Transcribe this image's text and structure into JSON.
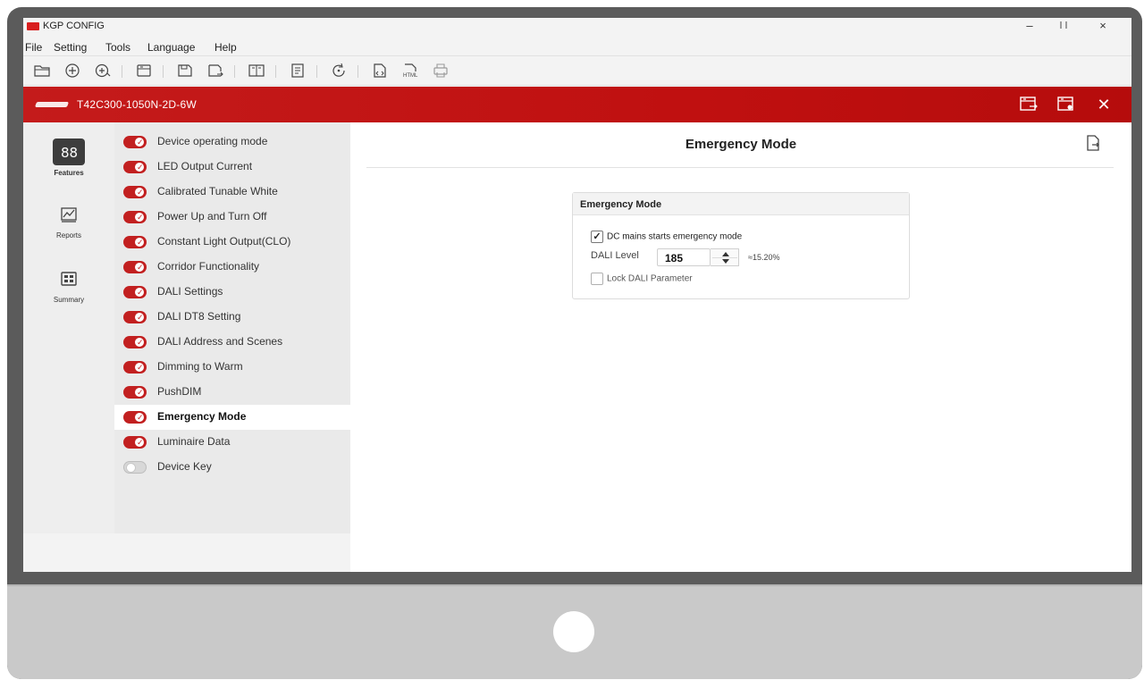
{
  "app": {
    "title": "KGP CONFIG",
    "window_controls": [
      "–",
      "□",
      "×"
    ]
  },
  "menu": [
    "File",
    "Setting",
    "Tools",
    "Language",
    "Help"
  ],
  "toolbar_icons": [
    "open-folder-icon",
    "new-icon",
    "add-device-icon",
    "device-icon",
    "save-icon",
    "save-as-icon",
    "compare-icon",
    "document-icon",
    "refresh-icon",
    "export-code-icon",
    "export-html-icon",
    "print-icon"
  ],
  "device": {
    "name": "T42C300-1050N-2D-6W",
    "actions": [
      "device-settings-icon",
      "device-config-icon",
      "close-icon"
    ],
    "close_glyph": "✕"
  },
  "rail": [
    {
      "label": "Features",
      "icon": "features-grid-icon",
      "active": true
    },
    {
      "label": "Reports",
      "icon": "reports-chart-icon",
      "active": false
    },
    {
      "label": "Summary",
      "icon": "summary-icon",
      "active": false
    }
  ],
  "features": [
    {
      "label": "Device operating mode",
      "enabled": true
    },
    {
      "label": "LED Output Current",
      "enabled": true
    },
    {
      "label": "Calibrated Tunable White",
      "enabled": true
    },
    {
      "label": "Power Up and Turn Off",
      "enabled": true
    },
    {
      "label": "Constant Light Output(CLO)",
      "enabled": true
    },
    {
      "label": "Corridor Functionality",
      "enabled": true
    },
    {
      "label": "DALI Settings",
      "enabled": true
    },
    {
      "label": "DALI DT8 Setting",
      "enabled": true
    },
    {
      "label": "DALI Address and Scenes",
      "enabled": true
    },
    {
      "label": "Dimming to Warm",
      "enabled": true
    },
    {
      "label": "PushDIM",
      "enabled": true
    },
    {
      "label": "Emergency Mode",
      "enabled": true,
      "active": true
    },
    {
      "label": "Luminaire Data",
      "enabled": true
    },
    {
      "label": "Device Key",
      "enabled": false
    }
  ],
  "main": {
    "title": "Emergency Mode",
    "card": {
      "header": "Emergency Mode",
      "dc_mains_label": "DC mains starts emergency mode",
      "dc_mains_checked": true,
      "dali_level_label": "DALI Level",
      "dali_level_value": "185",
      "dali_level_percent": "≈15.20%",
      "lock_label": "Lock DALI Parameter",
      "lock_checked": false
    }
  }
}
